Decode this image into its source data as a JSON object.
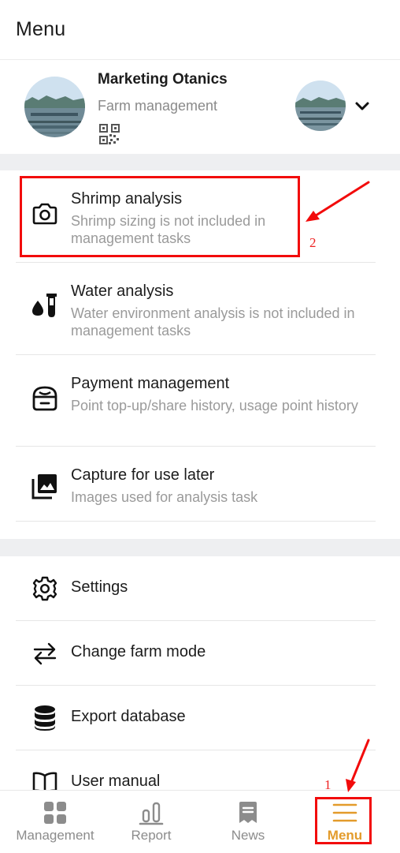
{
  "header": {
    "title": "Menu"
  },
  "profile": {
    "name": "Marketing Otanics",
    "subtitle": "Farm management",
    "icons": [
      "farm-photo-avatar",
      "qr-code-icon",
      "chevron-down-icon"
    ]
  },
  "analysis_items": [
    {
      "title": "Shrimp analysis",
      "desc": "Shrimp sizing is not included in management tasks",
      "icon": "camera-icon"
    },
    {
      "title": "Water analysis",
      "desc": "Water environment analysis is not included in management tasks",
      "icon": "water-test-icon"
    },
    {
      "title": "Payment management",
      "desc": "Point top-up/share history, usage point history",
      "icon": "wallet-icon"
    },
    {
      "title": "Capture for use later",
      "desc": "Images used for analysis task",
      "icon": "photo-library-icon"
    }
  ],
  "settings_items": [
    {
      "title": "Settings",
      "icon": "gear-icon"
    },
    {
      "title": "Change farm mode",
      "icon": "swap-arrows-icon"
    },
    {
      "title": "Export database",
      "icon": "database-icon"
    },
    {
      "title": "User manual",
      "icon": "book-icon"
    }
  ],
  "bottom_nav": [
    {
      "label": "Management",
      "icon": "grid-icon",
      "active": false
    },
    {
      "label": "Report",
      "icon": "bar-chart-icon",
      "active": false
    },
    {
      "label": "News",
      "icon": "news-icon",
      "active": false
    },
    {
      "label": "Menu",
      "icon": "menu-icon",
      "active": true
    }
  ],
  "annotations": {
    "step1": "1",
    "step2": "2"
  },
  "colors": {
    "accent": "#e39b2b",
    "annotation_red": "#f20b0b",
    "separator": "#eeeff1"
  }
}
